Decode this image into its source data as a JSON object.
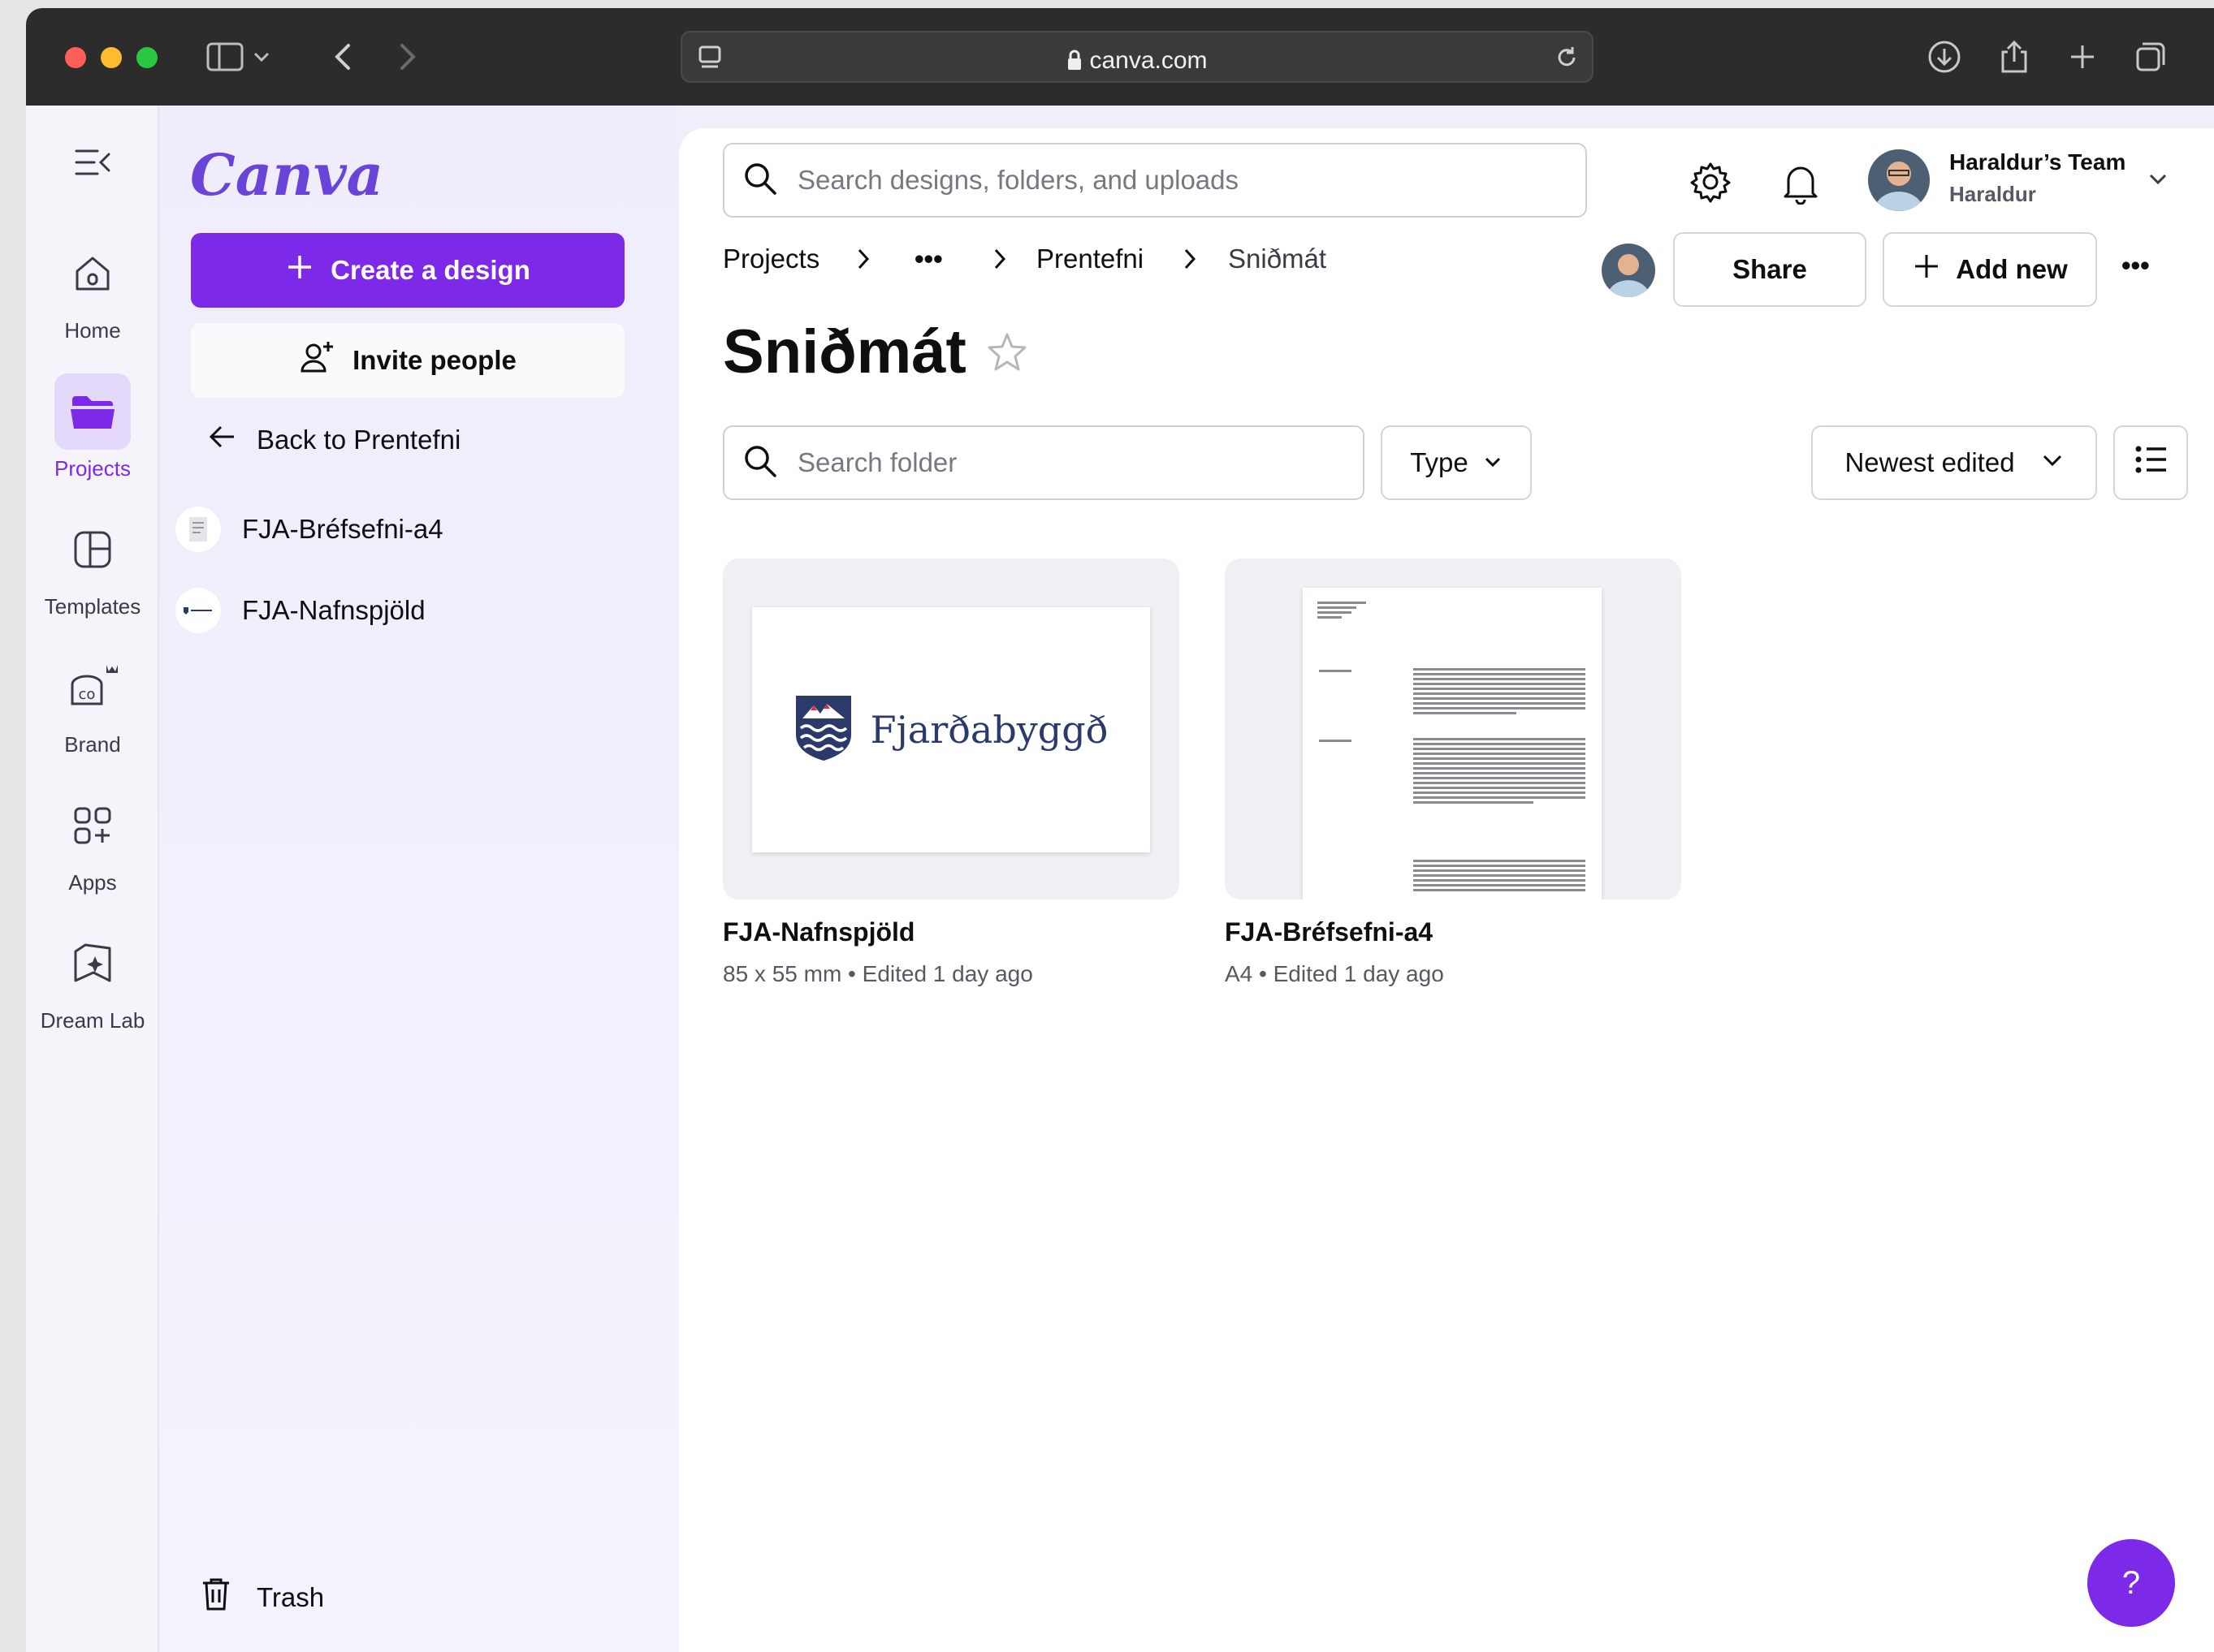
{
  "browser": {
    "url": "canva.com",
    "traffic_light_colors": [
      "#ff5f57",
      "#febc2e",
      "#28c840"
    ]
  },
  "rail": {
    "items": [
      {
        "label": "Home",
        "icon": "home-icon"
      },
      {
        "label": "Projects",
        "icon": "folder-icon",
        "active": true
      },
      {
        "label": "Templates",
        "icon": "templates-icon"
      },
      {
        "label": "Brand",
        "icon": "brand-icon"
      },
      {
        "label": "Apps",
        "icon": "apps-icon"
      },
      {
        "label": "Dream Lab",
        "icon": "dream-lab-icon"
      }
    ]
  },
  "panel": {
    "logo": "Canva",
    "create_label": "Create a design",
    "invite_label": "Invite people",
    "back_label": "Back to Prentefni",
    "designs": [
      "FJA-Bréfsefni-a4",
      "FJA-Nafnspjöld"
    ],
    "trash_label": "Trash"
  },
  "topbar": {
    "search_placeholder": "Search designs, folders, and uploads",
    "team_name": "Haraldur’s Team",
    "user_name": "Haraldur"
  },
  "breadcrumb": {
    "items": [
      "Projects",
      "•••",
      "Prentefni",
      "Sniðmát"
    ]
  },
  "actions": {
    "share_label": "Share",
    "add_new_label": "Add new",
    "more_label": "•••"
  },
  "folder": {
    "title": "Sniðmát",
    "search_placeholder": "Search folder",
    "type_label": "Type",
    "sort_label": "Newest edited"
  },
  "cards": [
    {
      "title": "FJA-Nafnspjöld",
      "meta": "85 x 55 mm • Edited 1 day ago",
      "thumb_text": "Fjarðabyggð"
    },
    {
      "title": "FJA-Bréfsefni-a4",
      "meta": "A4 • Edited 1 day ago"
    }
  ],
  "help_label": "?",
  "colors": {
    "accent": "#7d2ae8",
    "logo_text": "#2b3a6b"
  }
}
